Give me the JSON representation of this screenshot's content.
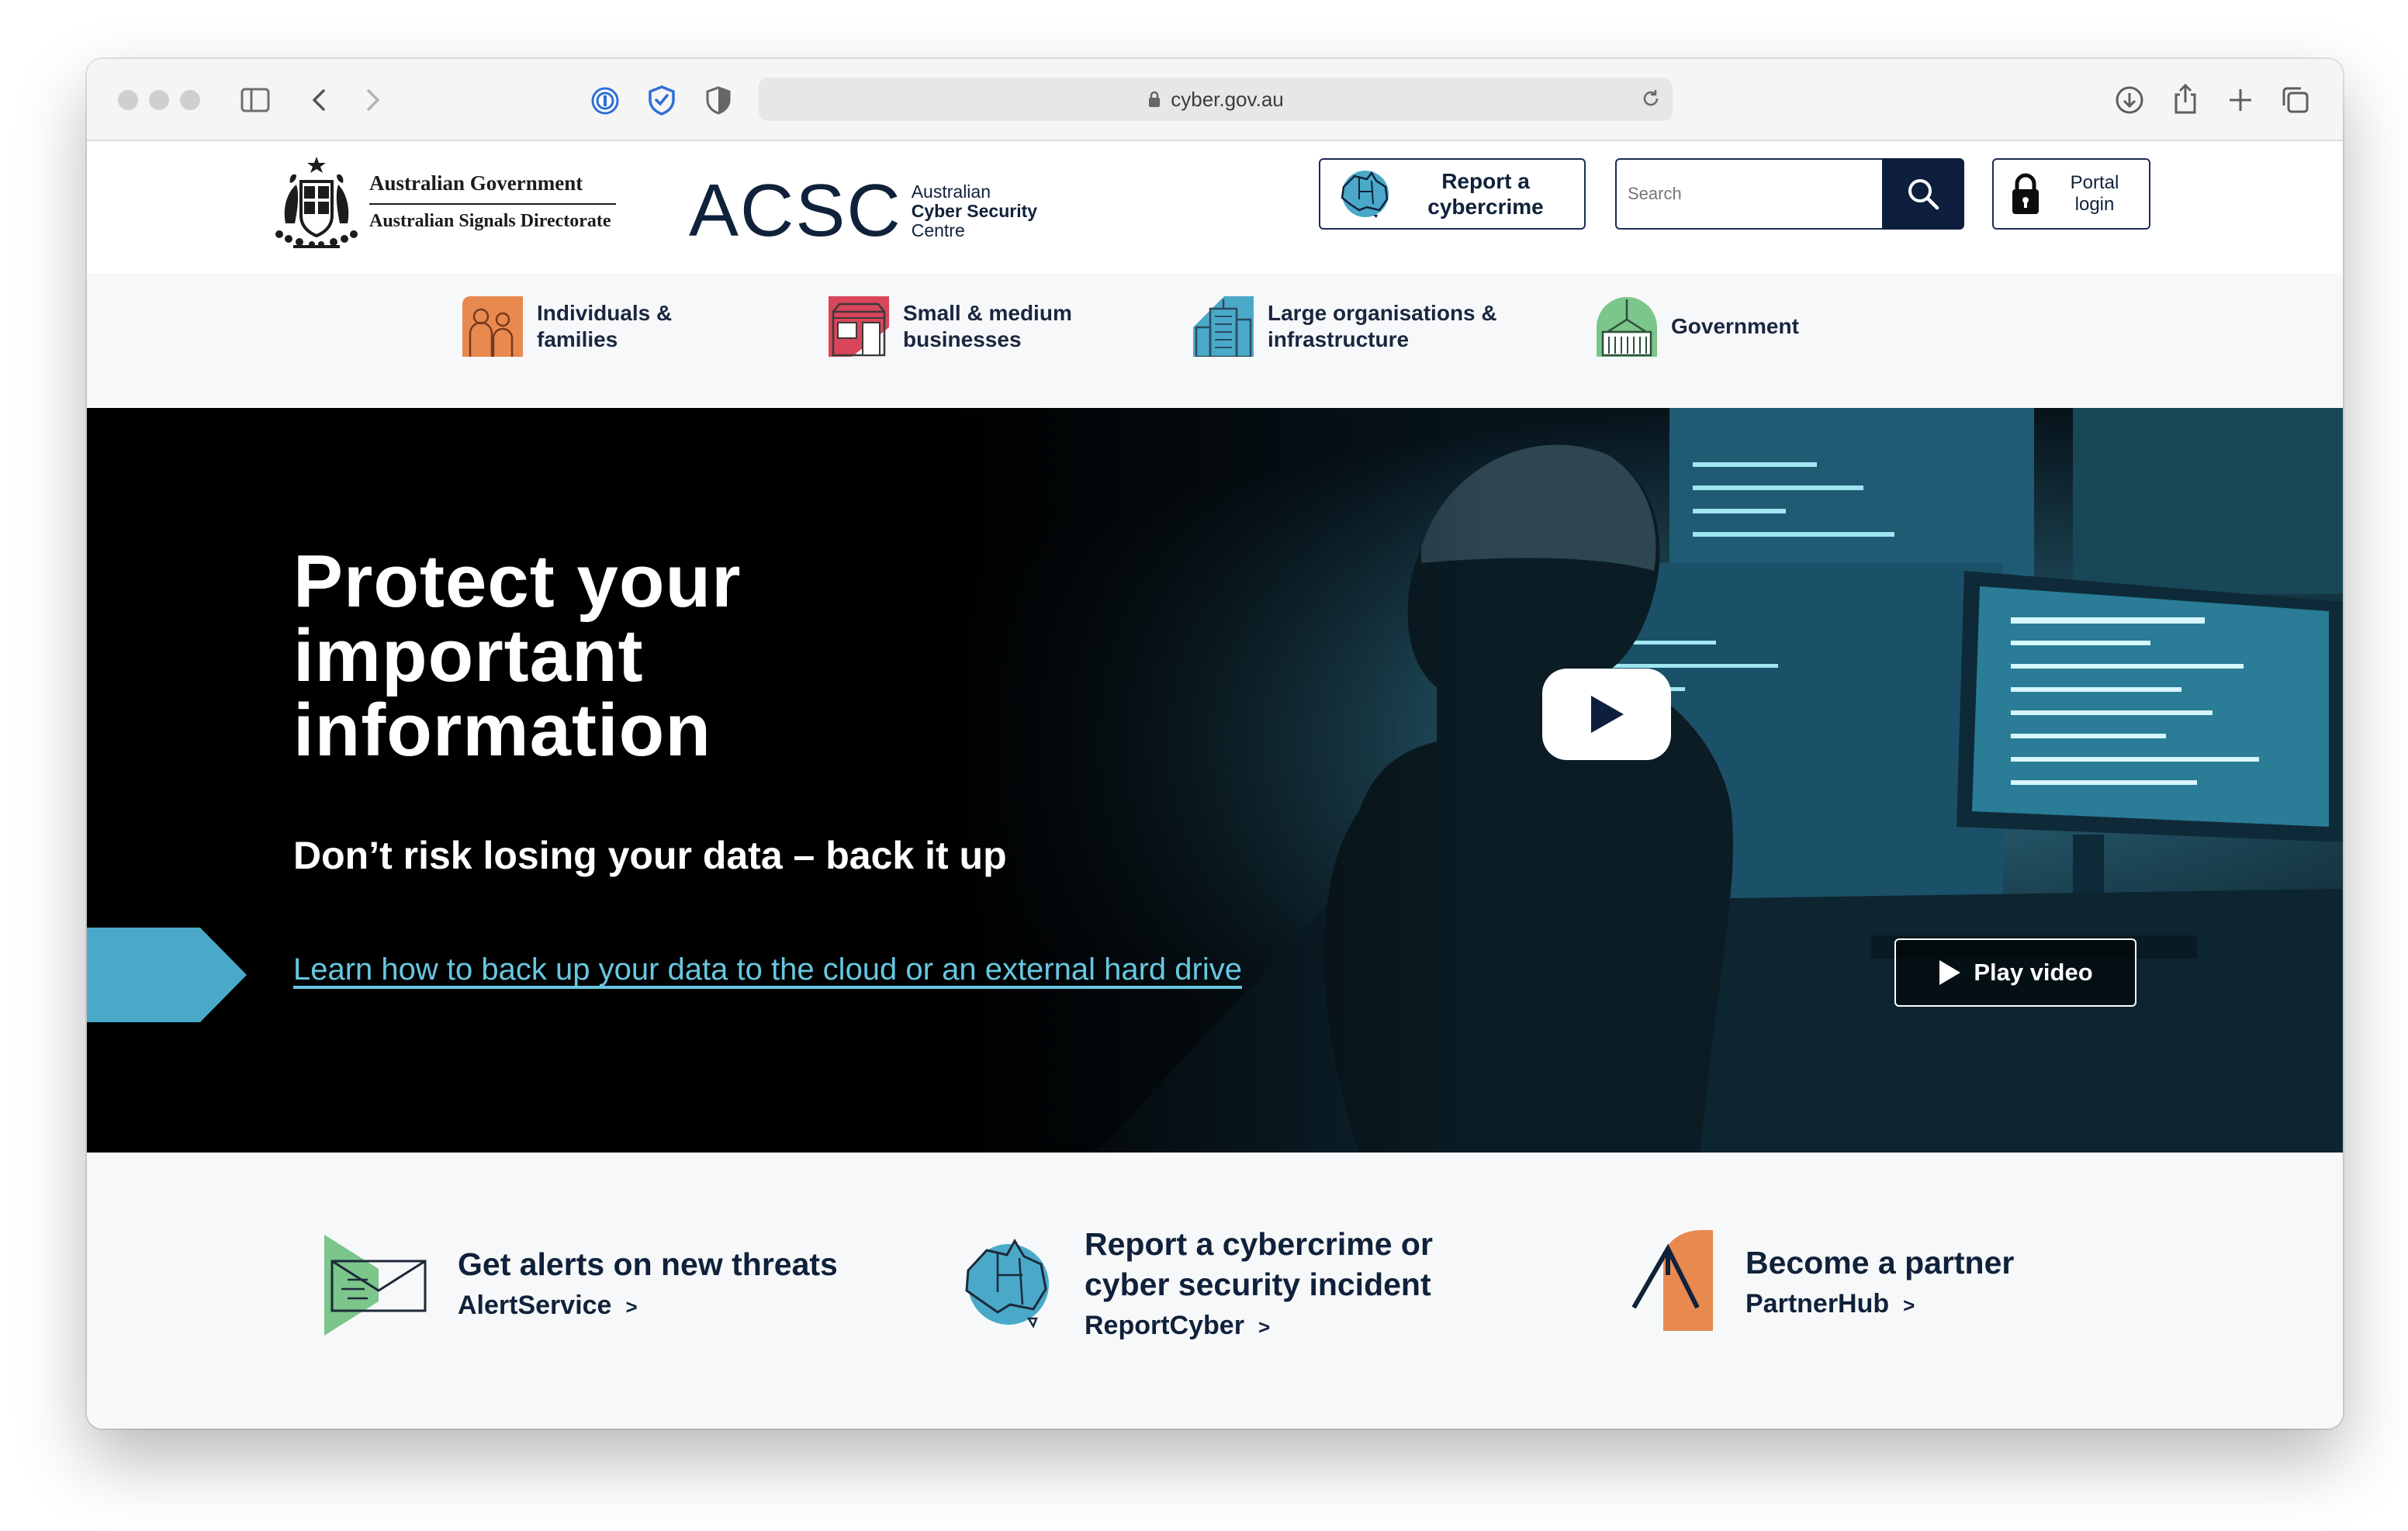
{
  "browser": {
    "url": "cyber.gov.au",
    "icons": [
      "sidebar-icon",
      "back-icon",
      "forward-icon",
      "password-manager-icon",
      "shield-check-icon",
      "privacy-shield-icon",
      "lock-icon",
      "reload-icon",
      "download-icon",
      "share-icon",
      "new-tab-icon",
      "tab-overview-icon"
    ]
  },
  "header": {
    "gov_line1": "Australian Government",
    "gov_line2": "Australian Signals Directorate",
    "acsc_word": "ACSC",
    "acsc_line1": "Australian",
    "acsc_line2": "Cyber Security",
    "acsc_line3": "Centre",
    "report_line1": "Report a",
    "report_line2": "cybercrime",
    "search_placeholder": "Search",
    "portal_line1": "Portal",
    "portal_line2": "login"
  },
  "audiences": [
    {
      "line1": "Individuals &",
      "line2": "families"
    },
    {
      "line1": "Small & medium",
      "line2": "businesses"
    },
    {
      "line1": "Large organisations &",
      "line2": "infrastructure"
    },
    {
      "line1": "Government",
      "line2": ""
    }
  ],
  "hero": {
    "title_line1": "Protect your",
    "title_line2": "important",
    "title_line3": "information",
    "subtitle": "Don’t risk losing your data – back it up",
    "link": "Learn how to back up your data to the cloud or an external hard drive",
    "play_label": "Play video"
  },
  "cards": [
    {
      "title_line1": "Get alerts on new threats",
      "title_line2": "",
      "link": "AlertService"
    },
    {
      "title_line1": "Report a cybercrime or",
      "title_line2": "cyber security incident",
      "link": "ReportCyber"
    },
    {
      "title_line1": "Become a partner",
      "title_line2": "",
      "link": "PartnerHub"
    }
  ],
  "colors": {
    "navy": "#10213a",
    "accent_blue": "#4aa9c9",
    "link_cyan": "#67c7e0",
    "orange": "#e8894f",
    "green": "#7cc58b"
  }
}
